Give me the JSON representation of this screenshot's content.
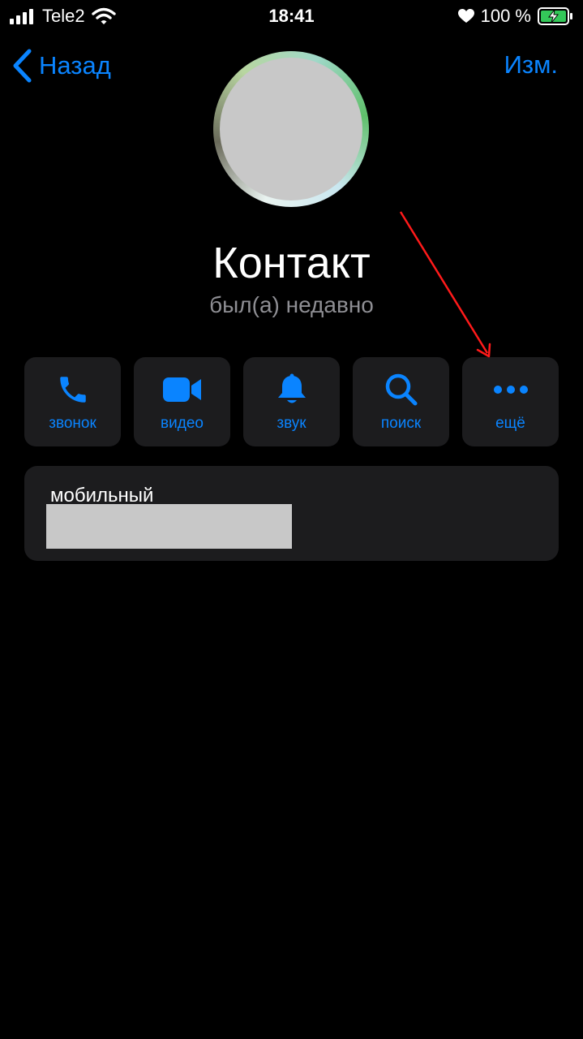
{
  "status_bar": {
    "carrier": "Tele2",
    "time": "18:41",
    "battery_percent": "100 %"
  },
  "nav": {
    "back_label": "Назад",
    "edit_label": "Изм."
  },
  "contact": {
    "name": "Контакт",
    "status": "был(а) недавно"
  },
  "actions": [
    {
      "label": "звонок",
      "icon": "phone-icon"
    },
    {
      "label": "видео",
      "icon": "video-camera-icon"
    },
    {
      "label": "звук",
      "icon": "bell-icon"
    },
    {
      "label": "поиск",
      "icon": "search-icon"
    },
    {
      "label": "ещё",
      "icon": "more-dots-icon"
    }
  ],
  "phone": {
    "label": "мобильный"
  },
  "colors": {
    "background": "#000000",
    "accent": "#0a84ff",
    "card": "#1c1c1e",
    "secondary_text": "#8e8e93",
    "annotation": "#ff1a1a",
    "battery": "#34c759"
  }
}
